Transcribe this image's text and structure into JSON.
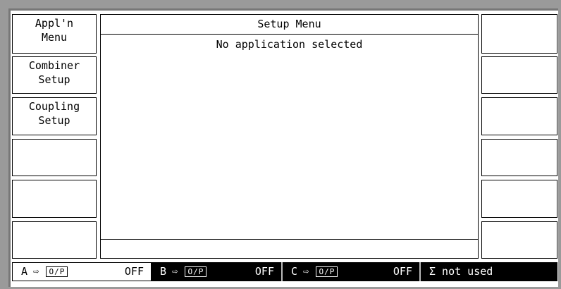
{
  "left_softkeys": [
    {
      "line1": "Appl'n",
      "line2": "Menu"
    },
    {
      "line1": "Combiner",
      "line2": "Setup"
    },
    {
      "line1": "Coupling",
      "line2": "Setup"
    },
    {
      "line1": "",
      "line2": ""
    },
    {
      "line1": "",
      "line2": ""
    },
    {
      "line1": "",
      "line2": ""
    }
  ],
  "right_softkeys": [
    {
      "label": ""
    },
    {
      "label": ""
    },
    {
      "label": ""
    },
    {
      "label": ""
    },
    {
      "label": ""
    },
    {
      "label": ""
    }
  ],
  "panel": {
    "title": "Setup Menu",
    "message": "No application selected",
    "status": ""
  },
  "channels": [
    {
      "name": "A",
      "arrow": "⇨",
      "output": "O/P",
      "state": "OFF"
    },
    {
      "name": "B",
      "arrow": "⇨",
      "output": "O/P",
      "state": "OFF"
    },
    {
      "name": "C",
      "arrow": "⇨",
      "output": "O/P",
      "state": "OFF"
    }
  ],
  "sigma": {
    "label": "Σ not used"
  },
  "colors": {
    "background": "#9a9a9a",
    "screen": "#ffffff",
    "ink": "#000000"
  }
}
